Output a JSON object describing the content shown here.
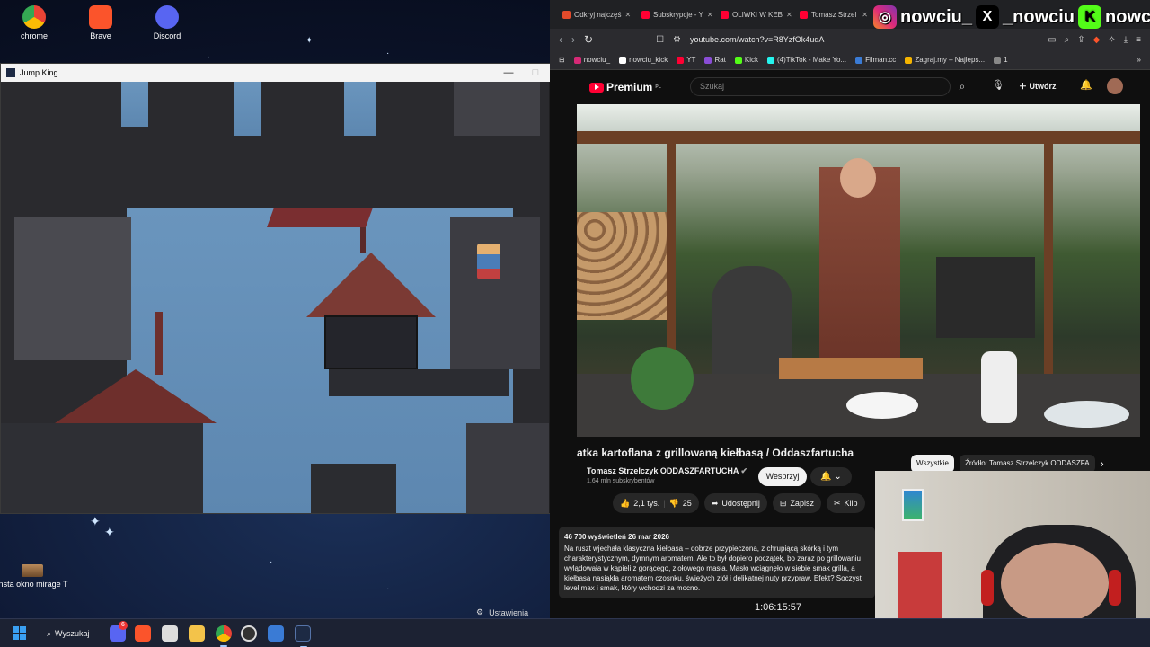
{
  "desktop": {
    "icons": [
      {
        "label": "chrome"
      },
      {
        "label": "Brave"
      },
      {
        "label": "Discord"
      }
    ],
    "file_icon_label": "insta okno mirage T"
  },
  "game_window": {
    "title": "Jump King",
    "minimize": "—",
    "maximize": "□",
    "close": "✕"
  },
  "browser": {
    "tabs": [
      {
        "label": "Odkryj najczęś",
        "color": "#e34b2b"
      },
      {
        "label": "Subskrypcje - Y",
        "color": "#ff0033"
      },
      {
        "label": "OLIWKI W KEB",
        "color": "#ff0033"
      },
      {
        "label": "Tomasz Strzel",
        "color": "#ff0033"
      }
    ],
    "url": "youtube.com/watch?v=R8YzfOk4udA",
    "bookmarks": [
      {
        "label": "nowciu_",
        "color": "#d62976"
      },
      {
        "label": "nowciu_kick",
        "color": "#ffffff"
      },
      {
        "label": "YT",
        "color": "#ff0033"
      },
      {
        "label": "Rat",
        "color": "#8a4dd6"
      },
      {
        "label": "Kick",
        "color": "#53fc18"
      },
      {
        "label": "(4)TikTok - Make Yo...",
        "color": "#25f4ee"
      },
      {
        "label": "Filman.cc",
        "color": "#3a7bd5"
      },
      {
        "label": "Zagraj.my – Najleps...",
        "color": "#f5b400"
      },
      {
        "label": "1",
        "color": "#888888"
      }
    ]
  },
  "socials": [
    "nowciu_",
    "_nowciu",
    "nowciu"
  ],
  "youtube": {
    "logo": "Premium",
    "logo_suffix": "PL",
    "search_placeholder": "Szukaj",
    "create": "Utwórz",
    "title": "atka kartoflana z grillowaną kiełbasą / Oddaszfartucha",
    "channel": "Tomasz Strzelczyk ODDASZFARTUCHA",
    "subscribers": "1,64 mln subskrybentów",
    "join": "Wesprzyj",
    "chips": [
      "Wszystkie",
      "Źródło: Tomasz Strzelczyk ODDASZFA"
    ],
    "chips_next": "›",
    "actions": {
      "likes": "2,1 tys.",
      "dislikes": "25",
      "share": "Udostępnij",
      "save": "Zapisz",
      "clip": "Klip"
    },
    "description": {
      "meta": "46 700 wyświetleń  26 mar 2026",
      "text": "Na ruszt wjechała klasyczna kiełbasa – dobrze przypieczona, z chrupiącą skórką i tym charakterystycznym, dymnym aromatem. Ale to był dopiero początek, bo zaraz po grillowaniu wylądowała w kąpieli z gorącego, ziołowego masła. Masło wciągnęło w siebie smak grilla, a kiełbasa nasiąkła aromatem czosnku, świeżych ziół i delikatnej nuty przypraw. Efekt? Soczyst level max i smak, który wchodzi za mocno."
    }
  },
  "settings_label": "Ustawienia",
  "timer": "1:06:15:57",
  "taskbar": {
    "search": "Wyszukaj",
    "badge": "6"
  }
}
